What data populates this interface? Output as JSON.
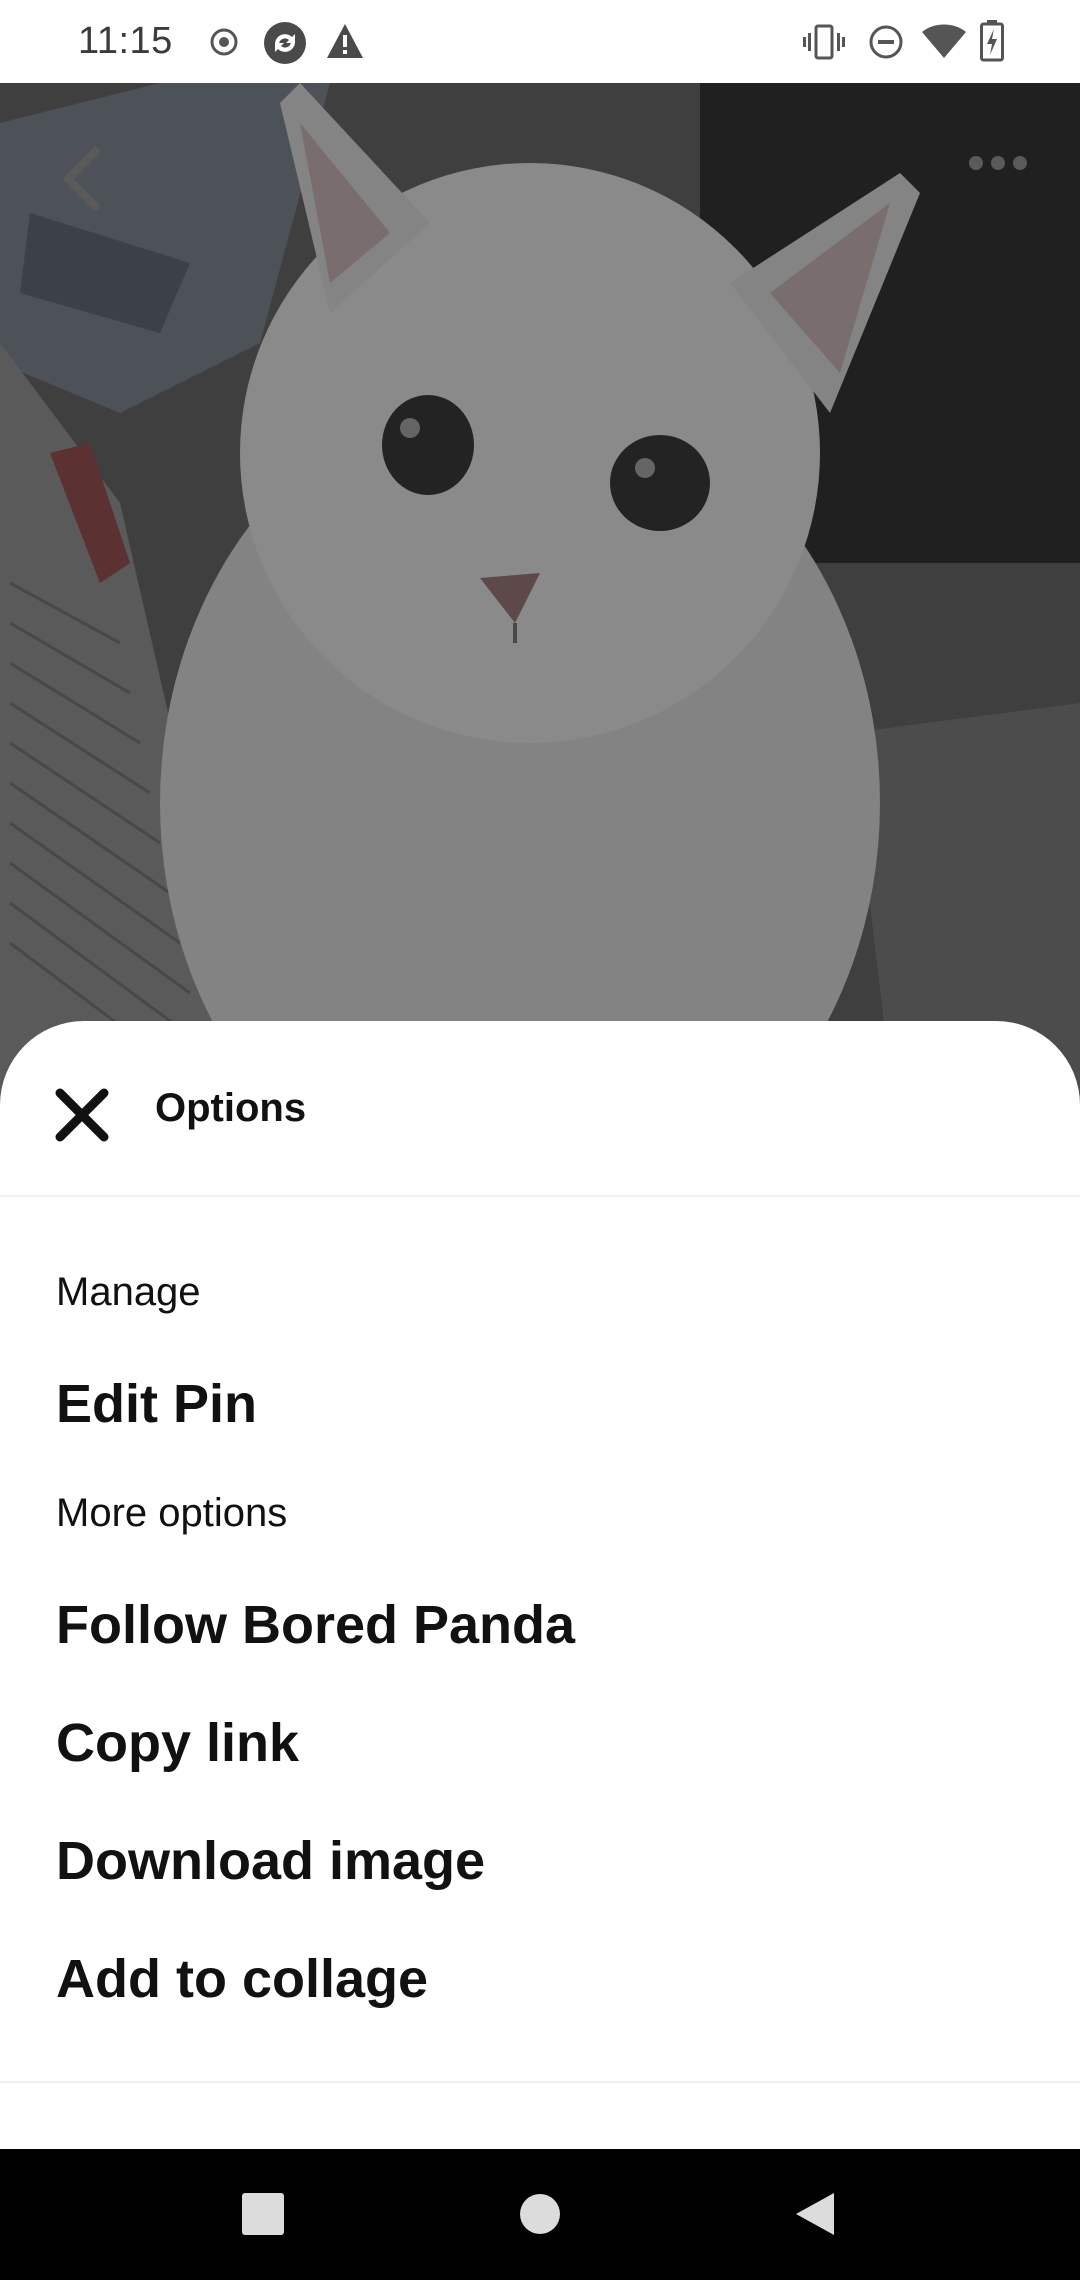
{
  "status_bar": {
    "time": "11:15",
    "left_icons": [
      "record-icon",
      "sync-icon",
      "warning-icon"
    ],
    "right_icons": [
      "vibrate-icon",
      "do-not-disturb-icon",
      "wifi-icon",
      "battery-charging-icon"
    ]
  },
  "photo": {
    "subject": "white kitten",
    "top_left_icon": "back-arrow-icon",
    "top_right_icon": "more-options-icon"
  },
  "sheet": {
    "title": "Options",
    "close_icon": "close-icon",
    "sections": [
      {
        "label": "Manage",
        "items": [
          "Edit Pin"
        ]
      },
      {
        "label": "More options",
        "items": [
          "Follow Bored Panda",
          "Copy link",
          "Download image",
          "Add to collage"
        ]
      }
    ]
  },
  "nav_bar": {
    "buttons": [
      "recents-icon",
      "home-icon",
      "back-icon"
    ]
  }
}
